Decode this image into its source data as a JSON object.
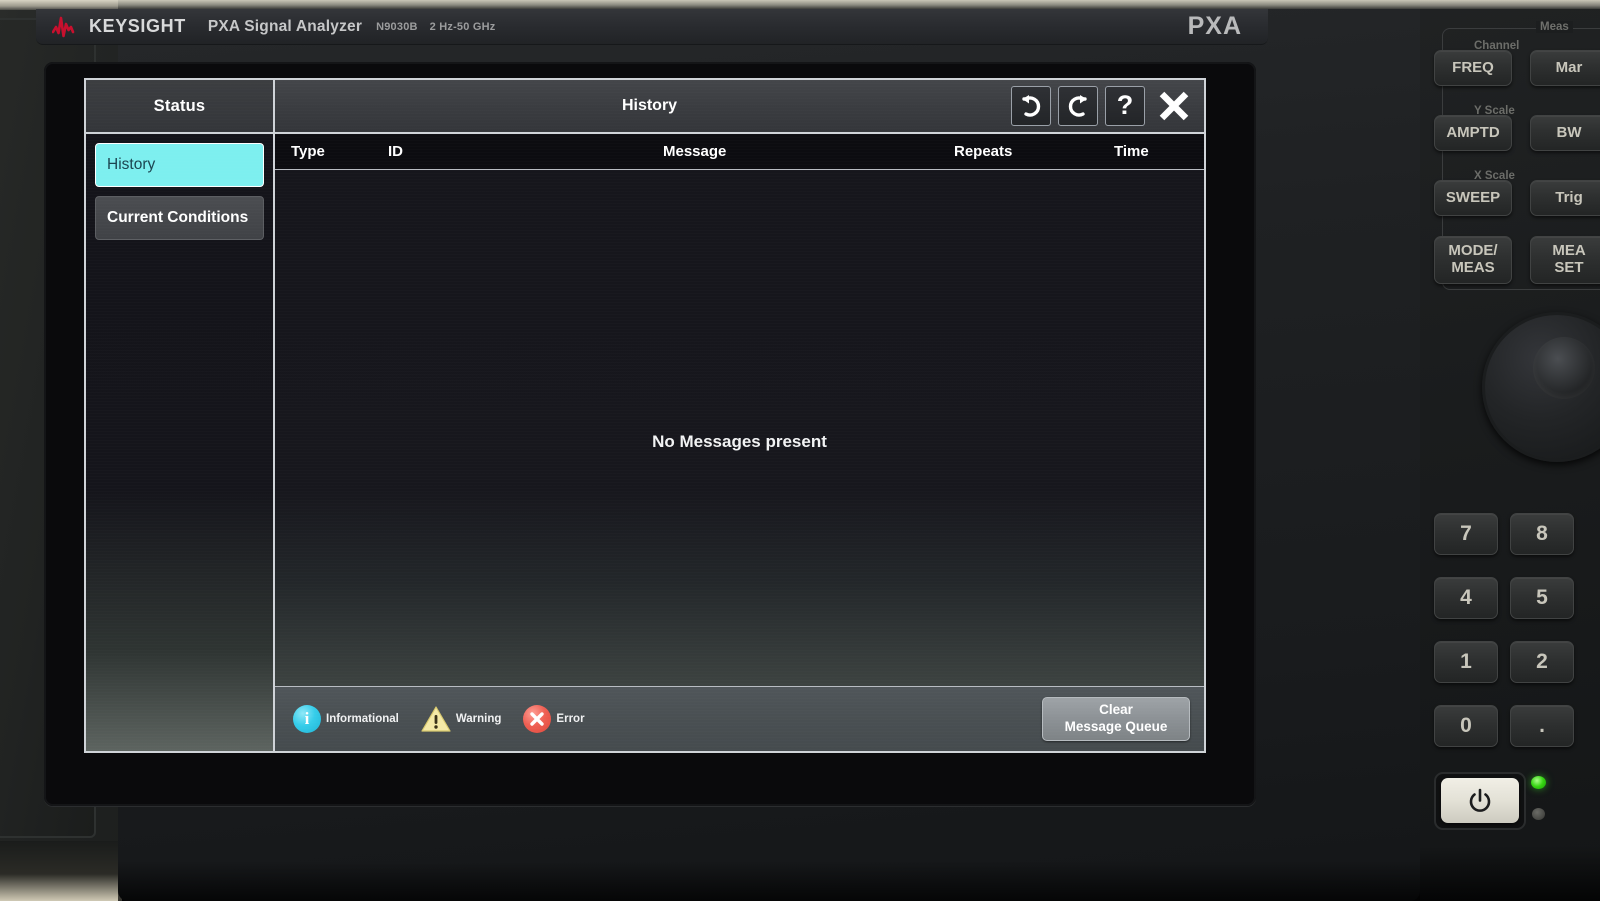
{
  "instrument": {
    "brand": "KEYSIGHT",
    "product": "PXA Signal Analyzer",
    "model": "N9030B",
    "freq_range": "2 Hz-50 GHz",
    "badge": "PXA"
  },
  "dialog": {
    "sidebar_header": "Status",
    "title": "History",
    "sidebar_items": [
      {
        "label": "History",
        "selected": true
      },
      {
        "label": "Current Conditions",
        "selected": false
      }
    ],
    "title_buttons": [
      {
        "name": "undo-button",
        "icon": "undo-icon",
        "label": ""
      },
      {
        "name": "redo-button",
        "icon": "redo-icon",
        "label": ""
      },
      {
        "name": "help-button",
        "icon": "question-mark-icon",
        "label": "?"
      },
      {
        "name": "close-button",
        "icon": "close-x-icon",
        "label": ""
      }
    ],
    "table": {
      "columns": [
        "Type",
        "ID",
        "Message",
        "Repeats",
        "Time"
      ],
      "rows": [],
      "empty_text": "No Messages present"
    },
    "legend": [
      {
        "icon": "info-icon",
        "glyph": "i",
        "label": "Informational",
        "color": "#2fc8e6"
      },
      {
        "icon": "warning-icon",
        "glyph": "!",
        "label": "Warning",
        "color": "#f2e49a"
      },
      {
        "icon": "error-icon",
        "glyph": "✕",
        "label": "Error",
        "color": "#ef6054"
      }
    ],
    "clear_button": {
      "line1": "Clear",
      "line2": "Message Queue"
    },
    "accent_color": "#7defef",
    "border_color": "#cfd3d8"
  },
  "hardware": {
    "groups": [
      {
        "label": "Meas"
      }
    ],
    "sublabels": [
      "Channel",
      "Y Scale",
      "X Scale"
    ],
    "keys": [
      {
        "label": "FREQ"
      },
      {
        "label": "Mar"
      },
      {
        "label": "AMPTD"
      },
      {
        "label": "BW"
      },
      {
        "label": "SWEEP"
      },
      {
        "label": "Trig"
      },
      {
        "label": "MODE/\nMEAS"
      },
      {
        "label": "MEA\nSET"
      }
    ],
    "keypad": [
      {
        "label": "7"
      },
      {
        "label": "8"
      },
      {
        "label": "4"
      },
      {
        "label": "5"
      },
      {
        "label": "1"
      },
      {
        "label": "2"
      },
      {
        "label": "0"
      },
      {
        "label": "."
      }
    ],
    "power": {
      "name": "power-button",
      "icon": "power-icon"
    }
  }
}
